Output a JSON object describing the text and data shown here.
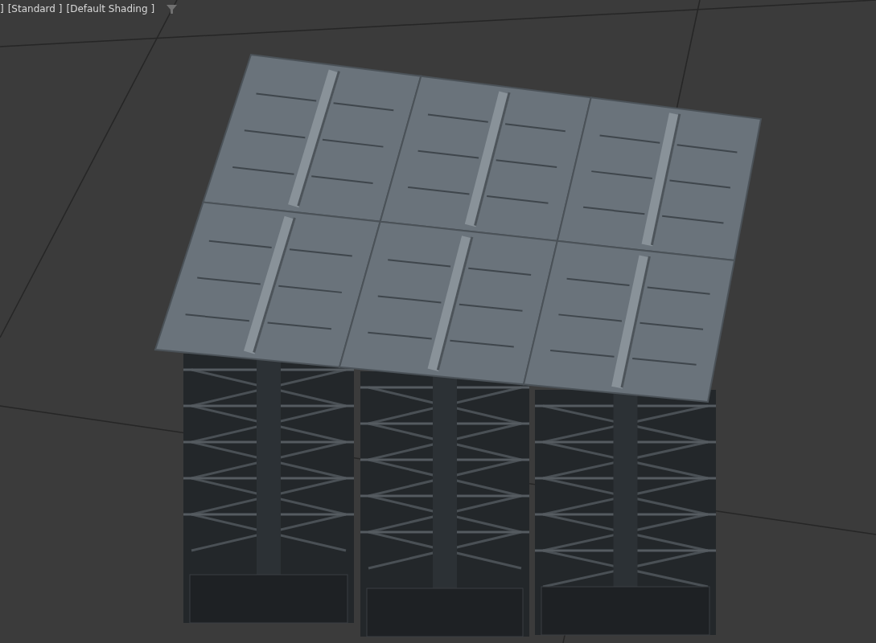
{
  "viewport_labels": [
    {
      "label": "]"
    },
    {
      "label": "[Standard ]"
    },
    {
      "label": "[Default Shading ]"
    }
  ]
}
